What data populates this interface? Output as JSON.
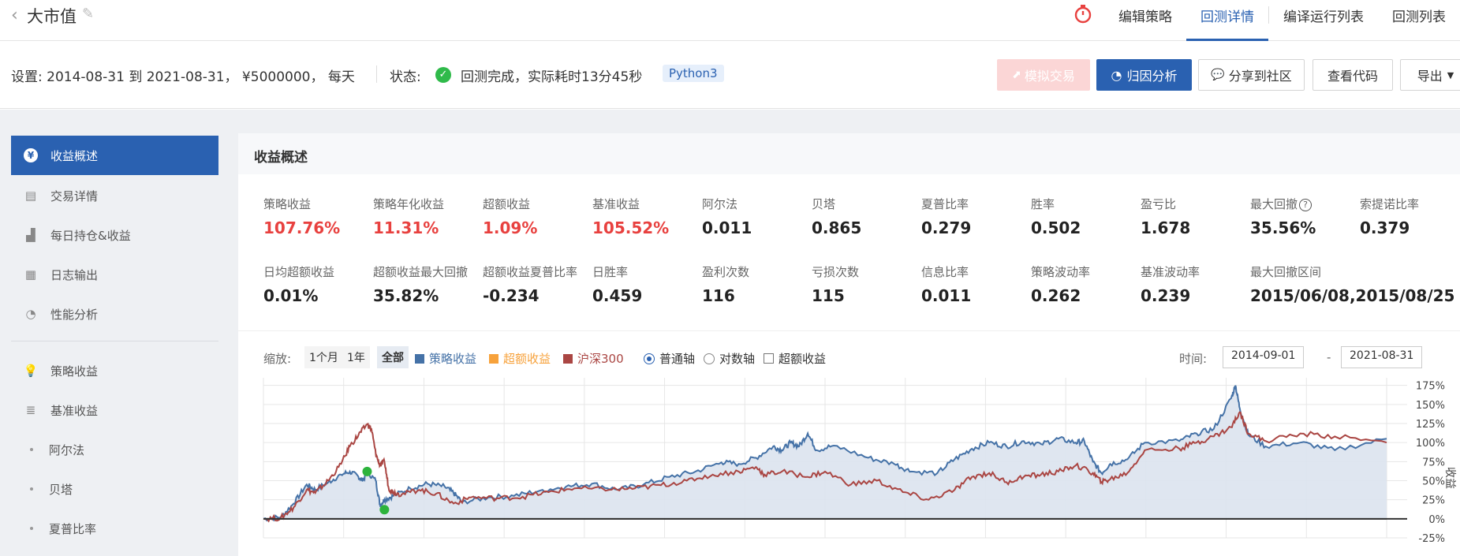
{
  "header": {
    "title": "大市值",
    "tabs": [
      {
        "label": "编辑策略",
        "active": false
      },
      {
        "label": "回测详情",
        "active": true
      },
      {
        "label": "编译运行列表",
        "active": false
      },
      {
        "label": "回测列表",
        "active": false
      }
    ]
  },
  "settings": {
    "text": "设置:  2014-08-31 到 2021-08-31，  ¥5000000，  每天",
    "status_label": "状态:",
    "status_text": "回测完成，实际耗时13分45秒",
    "python_badge": "Python3",
    "buttons": {
      "simulate": "模拟交易",
      "attribution": "归因分析",
      "share": "分享到社区",
      "view_code": "查看代码",
      "export": "导出"
    }
  },
  "sidebar": {
    "items": [
      {
        "label": "收益概述",
        "icon": "yuan-icon",
        "active": true
      },
      {
        "label": "交易详情",
        "icon": "document-icon"
      },
      {
        "label": "每日持仓&收益",
        "icon": "bar-chart-icon"
      },
      {
        "label": "日志输出",
        "icon": "calendar-icon"
      },
      {
        "label": "性能分析",
        "icon": "pie-icon"
      }
    ],
    "items2": [
      {
        "label": "策略收益",
        "icon": "lightbulb-icon"
      },
      {
        "label": "基准收益",
        "icon": "database-icon"
      }
    ],
    "sub_items": [
      "阿尔法",
      "贝塔",
      "夏普比率"
    ]
  },
  "panel": {
    "title": "收益概述",
    "metrics_row1": [
      {
        "label": "策略收益",
        "value": "107.76%",
        "red": true
      },
      {
        "label": "策略年化收益",
        "value": "11.31%",
        "red": true
      },
      {
        "label": "超额收益",
        "value": "1.09%",
        "red": true
      },
      {
        "label": "基准收益",
        "value": "105.52%",
        "red": true
      },
      {
        "label": "阿尔法",
        "value": "0.011"
      },
      {
        "label": "贝塔",
        "value": "0.865"
      },
      {
        "label": "夏普比率",
        "value": "0.279"
      },
      {
        "label": "胜率",
        "value": "0.502"
      },
      {
        "label": "盈亏比",
        "value": "1.678"
      },
      {
        "label": "最大回撤",
        "value": "35.56%"
      },
      {
        "label": "索提诺比率",
        "value": "0.379"
      }
    ],
    "metrics_row2": [
      {
        "label": "日均超额收益",
        "value": "0.01%"
      },
      {
        "label": "超额收益最大回撤",
        "value": "35.82%"
      },
      {
        "label": "超额收益夏普比率",
        "value": "-0.234"
      },
      {
        "label": "日胜率",
        "value": "0.459"
      },
      {
        "label": "盈利次数",
        "value": "116"
      },
      {
        "label": "亏损次数",
        "value": "115"
      },
      {
        "label": "信息比率",
        "value": "0.011"
      },
      {
        "label": "策略波动率",
        "value": "0.262"
      },
      {
        "label": "基准波动率",
        "value": "0.239"
      },
      {
        "label": "最大回撤区间",
        "value": "2015/06/08,2015/08/25"
      }
    ]
  },
  "controls": {
    "zoom_label": "缩放:",
    "zoom_options": [
      "1个月",
      "1年",
      "全部"
    ],
    "legend": [
      {
        "name": "策略收益",
        "color": "#4572a7"
      },
      {
        "name": "超额收益",
        "color": "#f7a23b"
      },
      {
        "name": "沪深300",
        "color": "#aa4643"
      }
    ],
    "axis_normal": "普通轴",
    "axis_log": "对数轴",
    "excess_toggle": "超额收益",
    "time_label": "时间:",
    "start_date": "2014-09-01",
    "end_date": "2021-08-31",
    "dash": "-"
  },
  "chart_data": {
    "type": "area",
    "y_axis_title": "收益",
    "yticks": [
      "175%",
      "150%",
      "125%",
      "100%",
      "75%",
      "50%",
      "25%",
      "0%",
      "-25%"
    ],
    "ylim": [
      -25,
      185
    ],
    "x_range": [
      "2014-09-01",
      "2021-08-31"
    ],
    "series": [
      {
        "name": "策略收益",
        "color": "#4572a7",
        "fill": "#dbe3ee",
        "points": [
          [
            0,
            0
          ],
          [
            0.02,
            2
          ],
          [
            0.035,
            20
          ],
          [
            0.05,
            45
          ],
          [
            0.06,
            38
          ],
          [
            0.075,
            48
          ],
          [
            0.09,
            58
          ],
          [
            0.1,
            62
          ],
          [
            0.11,
            55
          ],
          [
            0.115,
            50
          ],
          [
            0.12,
            62
          ],
          [
            0.13,
            50
          ],
          [
            0.135,
            18
          ],
          [
            0.14,
            25
          ],
          [
            0.15,
            30
          ],
          [
            0.17,
            40
          ],
          [
            0.19,
            46
          ],
          [
            0.21,
            42
          ],
          [
            0.22,
            34
          ],
          [
            0.23,
            22
          ],
          [
            0.26,
            28
          ],
          [
            0.29,
            30
          ],
          [
            0.32,
            37
          ],
          [
            0.35,
            42
          ],
          [
            0.38,
            46
          ],
          [
            0.41,
            38
          ],
          [
            0.44,
            45
          ],
          [
            0.47,
            55
          ],
          [
            0.5,
            62
          ],
          [
            0.53,
            74
          ],
          [
            0.55,
            72
          ],
          [
            0.57,
            80
          ],
          [
            0.59,
            95
          ],
          [
            0.6,
            90
          ],
          [
            0.61,
            100
          ],
          [
            0.62,
            95
          ],
          [
            0.63,
            112
          ],
          [
            0.64,
            90
          ],
          [
            0.66,
            96
          ],
          [
            0.7,
            80
          ],
          [
            0.73,
            72
          ],
          [
            0.75,
            62
          ],
          [
            0.78,
            60
          ],
          [
            0.8,
            78
          ],
          [
            0.82,
            92
          ],
          [
            0.84,
            100
          ],
          [
            0.86,
            95
          ],
          [
            0.88,
            102
          ],
          [
            0.9,
            98
          ],
          [
            0.92,
            105
          ],
          [
            0.94,
            100
          ],
          [
            0.95,
            102
          ],
          [
            0.96,
            75
          ],
          [
            0.97,
            60
          ],
          [
            0.98,
            72
          ],
          [
            1.0,
            78
          ],
          [
            1.02,
            100
          ],
          [
            1.06,
            102
          ],
          [
            1.08,
            112
          ],
          [
            1.1,
            118
          ],
          [
            1.12,
            158
          ],
          [
            1.125,
            175
          ],
          [
            1.13,
            145
          ],
          [
            1.14,
            110
          ],
          [
            1.16,
            95
          ],
          [
            1.2,
            100
          ],
          [
            1.24,
            90
          ],
          [
            1.3,
            105
          ]
        ]
      },
      {
        "name": "沪深300",
        "color": "#aa4643",
        "points": [
          [
            0,
            0
          ],
          [
            0.02,
            1
          ],
          [
            0.035,
            15
          ],
          [
            0.05,
            38
          ],
          [
            0.06,
            34
          ],
          [
            0.075,
            50
          ],
          [
            0.09,
            72
          ],
          [
            0.1,
            95
          ],
          [
            0.11,
            110
          ],
          [
            0.12,
            124
          ],
          [
            0.125,
            118
          ],
          [
            0.13,
            85
          ],
          [
            0.135,
            70
          ],
          [
            0.14,
            75
          ],
          [
            0.145,
            40
          ],
          [
            0.15,
            35
          ],
          [
            0.16,
            32
          ],
          [
            0.18,
            38
          ],
          [
            0.2,
            33
          ],
          [
            0.22,
            20
          ],
          [
            0.24,
            28
          ],
          [
            0.27,
            27
          ],
          [
            0.3,
            29
          ],
          [
            0.33,
            35
          ],
          [
            0.36,
            40
          ],
          [
            0.4,
            38
          ],
          [
            0.43,
            40
          ],
          [
            0.46,
            44
          ],
          [
            0.49,
            50
          ],
          [
            0.52,
            58
          ],
          [
            0.55,
            62
          ],
          [
            0.57,
            68
          ],
          [
            0.58,
            58
          ],
          [
            0.6,
            62
          ],
          [
            0.63,
            55
          ],
          [
            0.65,
            62
          ],
          [
            0.68,
            45
          ],
          [
            0.71,
            50
          ],
          [
            0.74,
            35
          ],
          [
            0.77,
            25
          ],
          [
            0.8,
            38
          ],
          [
            0.82,
            55
          ],
          [
            0.84,
            60
          ],
          [
            0.86,
            48
          ],
          [
            0.88,
            55
          ],
          [
            0.9,
            58
          ],
          [
            0.92,
            62
          ],
          [
            0.94,
            70
          ],
          [
            0.96,
            60
          ],
          [
            0.97,
            48
          ],
          [
            0.98,
            52
          ],
          [
            1.0,
            60
          ],
          [
            1.02,
            90
          ],
          [
            1.06,
            92
          ],
          [
            1.08,
            100
          ],
          [
            1.1,
            108
          ],
          [
            1.12,
            120
          ],
          [
            1.13,
            140
          ],
          [
            1.14,
            112
          ],
          [
            1.16,
            102
          ],
          [
            1.2,
            112
          ],
          [
            1.24,
            108
          ],
          [
            1.3,
            100
          ]
        ]
      }
    ],
    "markers": [
      {
        "x": 0.12,
        "y": 62,
        "color": "#2db33c"
      },
      {
        "x": 0.14,
        "y": 12,
        "color": "#2db33c"
      }
    ]
  }
}
